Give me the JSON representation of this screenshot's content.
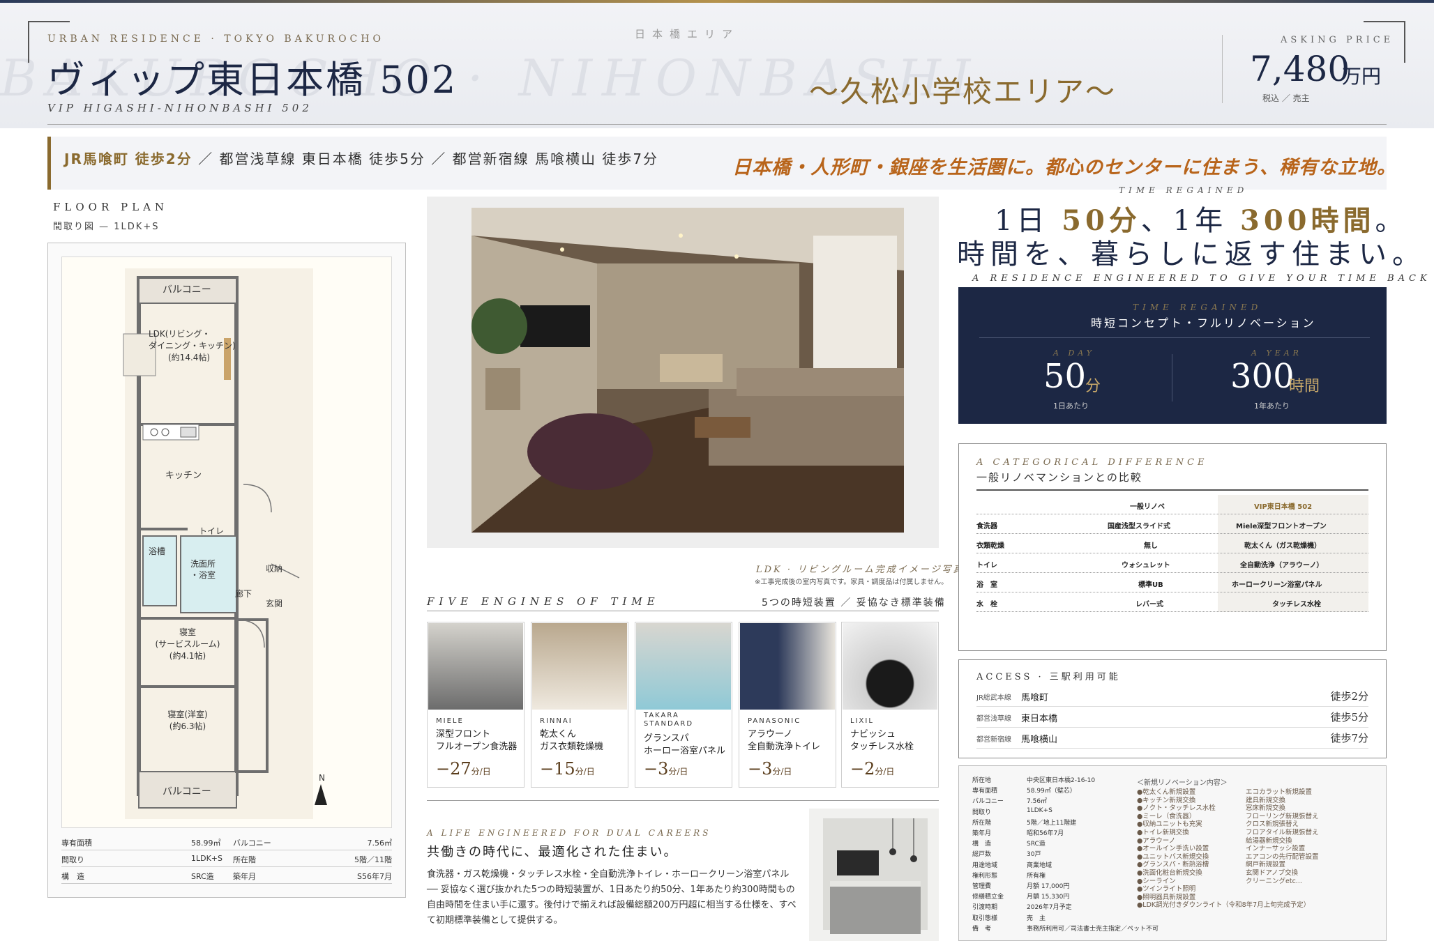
{
  "header": {
    "brand_sub": "URBAN RESIDENCE · TOKYO BAKUROCHO",
    "title": "ヴィップ東日本橋 502",
    "title_en": "VIP HIGASHI-NIHONBASHI 502",
    "watermark": "BAKUROCHO · NIHONBASHI",
    "area_label": "日本橋エリア",
    "area_tag": "〜久松小学校エリア〜",
    "price_label": "ASKING PRICE",
    "price_value": "7,480",
    "price_unit": "万円",
    "price_note": "税込 ／ 売主"
  },
  "access_band": {
    "prefix": "JR馬喰町 徒歩2分",
    "rest": "／ 都営浅草線 東日本橋 徒歩5分 ／ 都営新宿線 馬喰横山 徒歩7分",
    "tagline": "日本橋・人形町・銀座を生活圏に。都心のセンターに住まう、稀有な立地。"
  },
  "floor_plan": {
    "label": "FLOOR PLAN",
    "sub": "間取り図 — 1LDK+S",
    "rooms": {
      "balcony_top": "バルコニー",
      "ldk": "LDK(リビング・ダイニング・キッチン)(約14.4帖)",
      "ldk_l1": "LDK(リビング・",
      "ldk_l2": "ダイニング・キッチン)",
      "ldk_l3": "(約14.4帖)",
      "kitchen": "キッチン",
      "toilet": "トイレ",
      "bath": "浴槽",
      "washroom_l1": "洗面所",
      "washroom_l2": "・浴室",
      "storage": "収納",
      "hall": "廊下",
      "entrance": "玄関",
      "bedroom1_l1": "寝室",
      "bedroom1_l2": "(サービスルーム)",
      "bedroom1_l3": "(約4.1帖)",
      "bedroom2_l1": "寝室(洋室)",
      "bedroom2_l2": "(約6.3帖)",
      "balcony_bottom": "バルコニー",
      "north": "N"
    },
    "table": [
      {
        "k1": "専有面積",
        "v1": "58.99㎡",
        "k2": "バルコニー",
        "v2": "7.56㎡"
      },
      {
        "k1": "間取り",
        "v1": "1LDK+S",
        "k2": "所在階",
        "v2": "5階／11階"
      },
      {
        "k1": "構　造",
        "v1": "SRC造",
        "k2": "築年月",
        "v2": "S56年7月"
      }
    ]
  },
  "photo": {
    "caption": "LDK · リビングルーム完成イメージ写真",
    "note": "※工事完成後の室内写真です。家具・調度品は付属しません。"
  },
  "five_engines": {
    "title": "FIVE ENGINES OF TIME",
    "sub": "5つの時短装置 ／ 妥協なき標準装備",
    "items": [
      {
        "brand": "MIELE",
        "name1": "深型フロント",
        "name2": "フルオープン食洗器",
        "save": "−27",
        "unit": "分/日"
      },
      {
        "brand": "RINNAI",
        "name1": "乾太くん",
        "name2": "ガス衣類乾燥機",
        "save": "−15",
        "unit": "分/日"
      },
      {
        "brand": "TAKARA STANDARD",
        "name1": "グランスパ",
        "name2": "ホーロー浴室パネル",
        "save": "−3",
        "unit": "分/日"
      },
      {
        "brand": "PANASONIC",
        "name1": "アラウーノ",
        "name2": "全自動洗浄トイレ",
        "save": "−3",
        "unit": "分/日"
      },
      {
        "brand": "LIXIL",
        "name1": "ナビッシュ",
        "name2": "タッチレス水栓",
        "save": "−2",
        "unit": "分/日"
      }
    ]
  },
  "dual_careers": {
    "label": "A LIFE ENGINEERED FOR DUAL CAREERS",
    "title": "共働きの時代に、最適化された住まい。",
    "body": "食洗器・ガス乾燥機・タッチレス水栓・全自動洗浄トイレ・ホーロークリーン浴室パネル ── 妥協なく選び抜かれた5つの時短装置が、1日あたり約50分、1年あたり約300時間もの自由時間を住まい手に還す。後付けで揃えれば設備総額200万円超に相当する仕様を、すべて初期標準装備として提供する。"
  },
  "time": {
    "label": "TIME REGAINED",
    "h1_pre": "1日",
    "h1_a": "50分",
    "h1_mid": "、1年",
    "h1_b": "300時間",
    "h1_end": "。",
    "h2": "時間を、暮らしに返す住まい。",
    "en": "A RESIDENCE ENGINEERED TO GIVE YOUR TIME BACK"
  },
  "navy": {
    "label": "TIME REGAINED",
    "title": "時短コンセプト・フルリノベーション",
    "day_cap": "A DAY",
    "day_num": "50",
    "day_unit": "分",
    "day_note": "1日あたり",
    "year_cap": "A YEAR",
    "year_num": "300",
    "year_unit": "時間",
    "year_note": "1年あたり"
  },
  "compare": {
    "label": "A CATEGORICAL DIFFERENCE",
    "title": "一般リノベマンションとの比較",
    "head_general": "一般リノベ",
    "head_vip": "VIP東日本橋 502",
    "rows": [
      {
        "item": "食洗器",
        "general": "国産浅型スライド式",
        "vip": "Miele深型フロントオープン"
      },
      {
        "item": "衣類乾燥",
        "general": "無し",
        "vip": "乾太くん（ガス乾燥機）"
      },
      {
        "item": "トイレ",
        "general": "ウォシュレット",
        "vip": "全自動洗浄（アラウーノ）"
      },
      {
        "item": "浴　室",
        "general": "標準UB",
        "vip": "ホーロークリーン浴室パネル"
      },
      {
        "item": "水　栓",
        "general": "レバー式",
        "vip": "タッチレス水栓"
      }
    ]
  },
  "access": {
    "label": "ACCESS · 三駅利用可能",
    "rows": [
      {
        "line": "JR総武本線",
        "station": "馬喰町",
        "walk": "徒歩2分"
      },
      {
        "line": "都営浅草線",
        "station": "東日本橋",
        "walk": "徒歩5分"
      },
      {
        "line": "都営新宿線",
        "station": "馬喰横山",
        "walk": "徒歩7分"
      }
    ]
  },
  "spec": {
    "rows": [
      {
        "k": "所在地",
        "v": "中央区東日本橋2-16-10"
      },
      {
        "k": "専有面積",
        "v": "58.99㎡（壁芯）"
      },
      {
        "k": "バルコニー",
        "v": "7.56㎡"
      },
      {
        "k": "間取り",
        "v": "1LDK+S"
      },
      {
        "k": "所在階",
        "v": "5階／地上11階建"
      },
      {
        "k": "築年月",
        "v": "昭和56年7月"
      },
      {
        "k": "構　造",
        "v": "SRC造"
      },
      {
        "k": "総戸数",
        "v": "30戸"
      },
      {
        "k": "用途地域",
        "v": "商業地域"
      },
      {
        "k": "権利形態",
        "v": "所有権"
      },
      {
        "k": "管理費",
        "v": "月額 17,000円"
      },
      {
        "k": "修繕積立金",
        "v": "月額 15,330円"
      },
      {
        "k": "引渡時期",
        "v": "2026年7月予定"
      },
      {
        "k": "取引態様",
        "v": "売　主"
      },
      {
        "k": "備　考",
        "v": "事務所利用可／司法書士売主指定／ペット不可"
      }
    ],
    "reno_title": "＜新規リノベーション内容＞",
    "reno_col1": [
      "●乾太くん新規設置",
      "●キッチン新規交換",
      "●ノクト・タッチレス水栓",
      "●ミーレ（食洗器）",
      "●収納ユニットも充実",
      "●トイレ新規交換",
      "●アラウーノ",
      "●オールイン手洗い設置",
      "●ユニットバス新規交換",
      "●グランスパ・断熱浴槽",
      "●洗面化粧台新規交換",
      "●シーライン",
      "●ツインライト照明",
      "●照明器具新規設置",
      "●LDK調光付きダウンライト（令和8年7月上旬完成予定）"
    ],
    "reno_col2": [
      "エコカラット新規設置",
      "建具新規交換",
      "窓床新規交換",
      "フローリング新規張替え",
      "クロス新規張替え",
      "フロアタイル新規張替え",
      "給湯器新規交換",
      "インナーサッシ設置",
      "エアコンの先行配管設置",
      "網戸新規設置",
      "玄関ドアノブ交換",
      "クリーニングetc..."
    ]
  },
  "colors": {
    "navy": "#1c2744",
    "gold": "#8a6a2e",
    "orange": "#b8641a"
  }
}
